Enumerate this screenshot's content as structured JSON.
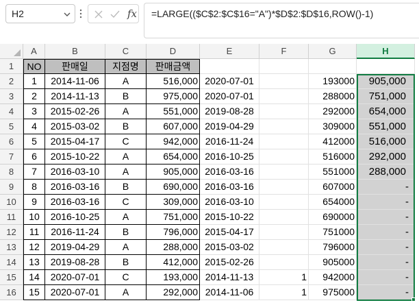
{
  "formula_bar": {
    "name_box": "H2",
    "cancel_icon": "close-icon",
    "enter_icon": "check-icon",
    "fx_label": "fx",
    "formula": "=LARGE(($C$2:$C$16=\"A\")*$D$2:$D$16,ROW()-1)"
  },
  "columns": [
    "A",
    "B",
    "C",
    "D",
    "E",
    "F",
    "G",
    "H"
  ],
  "selected_column": "H",
  "row_numbers": [
    "1",
    "2",
    "3",
    "4",
    "5",
    "6",
    "7",
    "8",
    "9",
    "10",
    "11",
    "12",
    "13",
    "14",
    "15",
    "16"
  ],
  "table_header": {
    "no": "NO",
    "date": "판매일",
    "branch": "지점명",
    "amount": "판매금액"
  },
  "rows": [
    {
      "a": "1",
      "b": "2014-11-06",
      "c": "A",
      "d": "516,000",
      "e": "2020-07-01",
      "f": "",
      "g": "193000",
      "h": "905,000"
    },
    {
      "a": "2",
      "b": "2014-11-13",
      "c": "B",
      "d": "975,000",
      "e": "2020-07-01",
      "f": "",
      "g": "288000",
      "h": "751,000"
    },
    {
      "a": "3",
      "b": "2015-02-26",
      "c": "A",
      "d": "551,000",
      "e": "2019-08-28",
      "f": "",
      "g": "292000",
      "h": "654,000"
    },
    {
      "a": "4",
      "b": "2015-03-02",
      "c": "B",
      "d": "607,000",
      "e": "2019-04-29",
      "f": "",
      "g": "309000",
      "h": "551,000"
    },
    {
      "a": "5",
      "b": "2015-04-17",
      "c": "C",
      "d": "942,000",
      "e": "2016-11-24",
      "f": "",
      "g": "412000",
      "h": "516,000"
    },
    {
      "a": "6",
      "b": "2015-10-22",
      "c": "A",
      "d": "654,000",
      "e": "2016-10-25",
      "f": "",
      "g": "516000",
      "h": "292,000"
    },
    {
      "a": "7",
      "b": "2016-03-10",
      "c": "A",
      "d": "905,000",
      "e": "2016-03-16",
      "f": "",
      "g": "551000",
      "h": "288,000"
    },
    {
      "a": "8",
      "b": "2016-03-16",
      "c": "B",
      "d": "690,000",
      "e": "2016-03-16",
      "f": "",
      "g": "607000",
      "h": "-"
    },
    {
      "a": "9",
      "b": "2016-03-16",
      "c": "C",
      "d": "309,000",
      "e": "2016-03-10",
      "f": "",
      "g": "654000",
      "h": "-"
    },
    {
      "a": "10",
      "b": "2016-10-25",
      "c": "A",
      "d": "751,000",
      "e": "2015-10-22",
      "f": "",
      "g": "690000",
      "h": "-"
    },
    {
      "a": "11",
      "b": "2016-11-24",
      "c": "B",
      "d": "796,000",
      "e": "2015-04-17",
      "f": "",
      "g": "751000",
      "h": "-"
    },
    {
      "a": "12",
      "b": "2019-04-29",
      "c": "A",
      "d": "288,000",
      "e": "2015-03-02",
      "f": "",
      "g": "796000",
      "h": "-"
    },
    {
      "a": "13",
      "b": "2019-08-28",
      "c": "B",
      "d": "412,000",
      "e": "2015-02-26",
      "f": "",
      "g": "905000",
      "h": "-"
    },
    {
      "a": "14",
      "b": "2020-07-01",
      "c": "C",
      "d": "193,000",
      "e": "2014-11-13",
      "f": "1",
      "g": "942000",
      "h": "-"
    },
    {
      "a": "15",
      "b": "2020-07-01",
      "c": "A",
      "d": "292,000",
      "e": "2014-11-06",
      "f": "1",
      "g": "975000",
      "h": "-"
    }
  ],
  "colors": {
    "accent": "#107c41",
    "header_fill": "#bfbfbf",
    "selection_fill": "#d2d2d2"
  }
}
